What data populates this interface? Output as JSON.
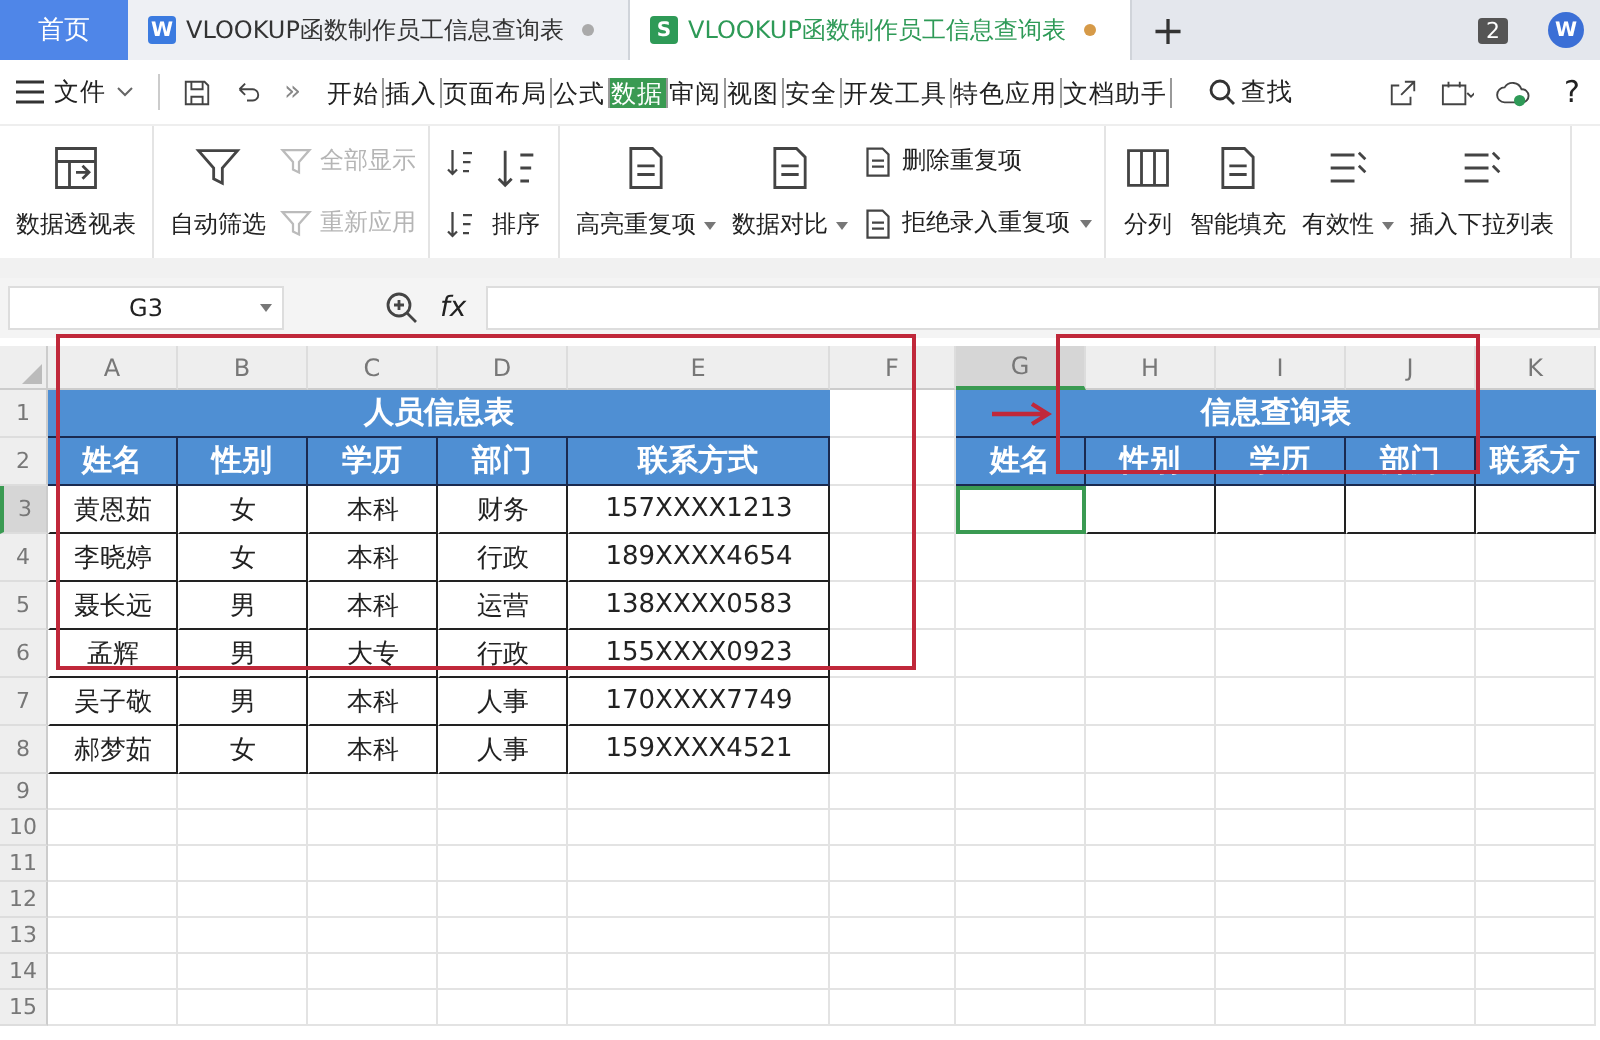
{
  "tabs": [
    {
      "kind": "home",
      "label": "首页",
      "selected": false
    },
    {
      "kind": "doc",
      "app": "W",
      "label": "VLOOKUP函数制作员工信息查询表",
      "selected": false
    },
    {
      "kind": "doc",
      "app": "S",
      "label": "VLOOKUP函数制作员工信息查询表",
      "selected": true
    }
  ],
  "new_tab": "+",
  "window_count": "2",
  "account": "W",
  "menu": {
    "file": "文件",
    "more": "»",
    "search": "查找",
    "help": "?",
    "ribbon_tabs": [
      {
        "label": "开始",
        "selected": false
      },
      {
        "label": "插入",
        "selected": false
      },
      {
        "label": "页面布局",
        "selected": false
      },
      {
        "label": "公式",
        "selected": false
      },
      {
        "label": "数据",
        "selected": true
      },
      {
        "label": "审阅",
        "selected": false
      },
      {
        "label": "视图",
        "selected": false
      },
      {
        "label": "安全",
        "selected": false
      },
      {
        "label": "开发工具",
        "selected": false
      },
      {
        "label": "特色应用",
        "selected": false
      },
      {
        "label": "文档助手",
        "selected": false
      }
    ]
  },
  "ribbon_groups": [
    [
      {
        "kind": "large",
        "label": "数据透视表",
        "disabled": false,
        "dropdown": false
      }
    ],
    [
      {
        "kind": "large",
        "label": "自动筛选",
        "disabled": false,
        "dropdown": false
      },
      {
        "kind": "small",
        "label": "全部显示",
        "disabled": true,
        "dropdown": false
      },
      {
        "kind": "small",
        "label": "重新应用",
        "disabled": true,
        "dropdown": false
      }
    ],
    [
      {
        "kind": "small",
        "disabled": false,
        "dropdown": false
      },
      {
        "kind": "small",
        "disabled": false,
        "dropdown": false
      },
      {
        "kind": "large",
        "label": "排序",
        "disabled": false,
        "dropdown": false
      }
    ],
    [
      {
        "kind": "large",
        "label": "高亮重复项",
        "disabled": false,
        "dropdown": true
      },
      {
        "kind": "large",
        "label": "数据对比",
        "disabled": false,
        "dropdown": true
      },
      {
        "kind": "small",
        "label": "删除重复项",
        "disabled": false,
        "dropdown": false
      },
      {
        "kind": "small",
        "label": "拒绝录入重复项",
        "disabled": false,
        "dropdown": true
      }
    ],
    [
      {
        "kind": "large",
        "label": "分列",
        "disabled": false,
        "dropdown": false
      },
      {
        "kind": "large",
        "label": "智能填充",
        "disabled": false,
        "dropdown": false
      },
      {
        "kind": "large",
        "label": "有效性",
        "disabled": false,
        "dropdown": true
      },
      {
        "kind": "large",
        "label": "插入下拉列表",
        "disabled": false,
        "dropdown": false
      }
    ]
  ],
  "formula_bar": {
    "name_box": "G3",
    "fx": "fx"
  },
  "sheet": {
    "columns": [
      "A",
      "B",
      "C",
      "D",
      "E",
      "F",
      "G",
      "H",
      "I",
      "J",
      "K"
    ],
    "rows": [
      "1",
      "2",
      "3",
      "4",
      "5",
      "6",
      "7",
      "8",
      "9",
      "10",
      "11",
      "12",
      "13",
      "14",
      "15"
    ],
    "left_table": {
      "title": "人员信息表",
      "headers": [
        "姓名",
        "性别",
        "学历",
        "部门",
        "联系方式"
      ],
      "rows": [
        [
          "黄恩茹",
          "女",
          "本科",
          "财务",
          "157XXXX1213"
        ],
        [
          "李晓婷",
          "女",
          "本科",
          "行政",
          "189XXXX4654"
        ],
        [
          "聂长远",
          "男",
          "本科",
          "运营",
          "138XXXX0583"
        ],
        [
          "孟辉",
          "男",
          "大专",
          "行政",
          "155XXXX0923"
        ],
        [
          "吴子敬",
          "男",
          "本科",
          "人事",
          "170XXXX7749"
        ],
        [
          "郝梦茹",
          "女",
          "本科",
          "人事",
          "159XXXX4521"
        ]
      ]
    },
    "right_table": {
      "title": "信息查询表",
      "headers": [
        "姓名",
        "性别",
        "学历",
        "部门",
        "联系方"
      ],
      "input_cells": [
        {
          "selected": true
        },
        {
          "selected": false
        },
        {
          "selected": false
        },
        {
          "selected": false
        },
        {
          "selected": false
        }
      ]
    }
  }
}
